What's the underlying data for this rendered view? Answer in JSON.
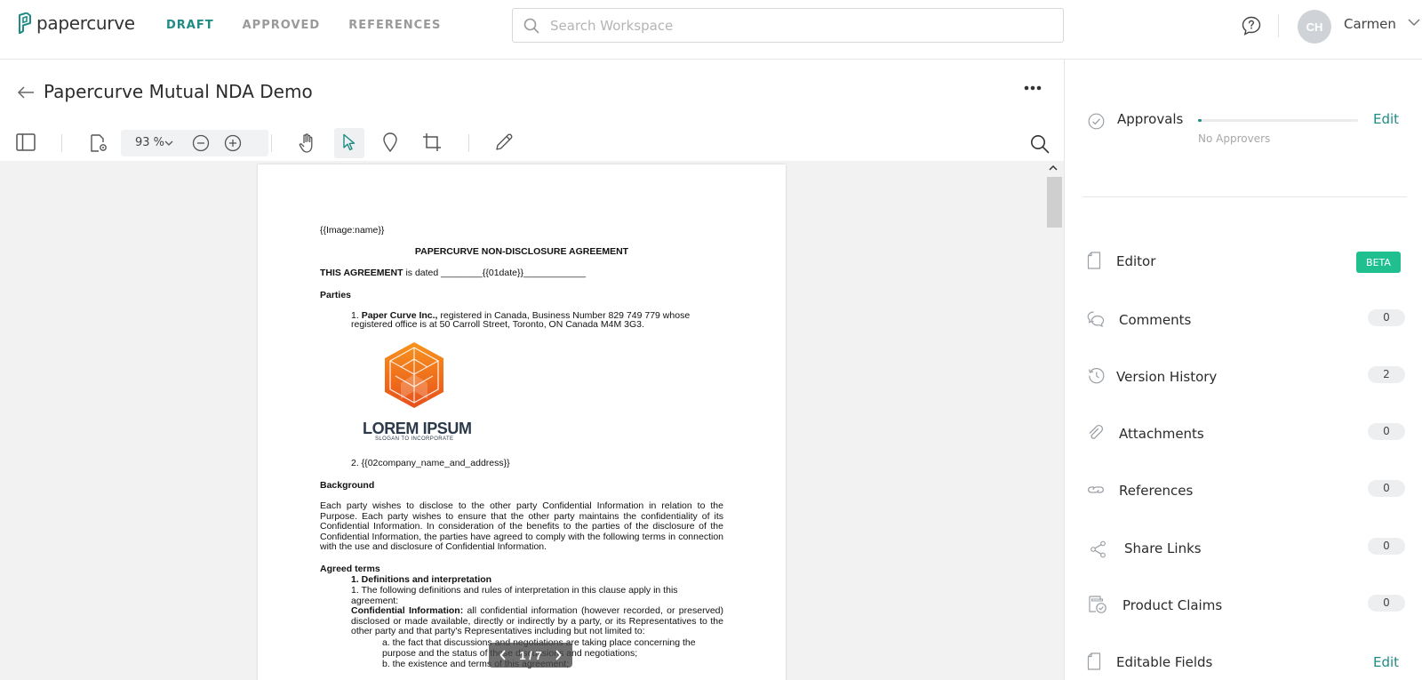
{
  "app": {
    "logo_text": "papercurve",
    "nav": [
      {
        "label": "DRAFT",
        "active": true
      },
      {
        "label": "APPROVED",
        "active": false
      },
      {
        "label": "REFERENCES",
        "active": false
      }
    ],
    "search_placeholder": "Search Workspace",
    "user": {
      "initials": "CH",
      "name": "Carmen"
    },
    "accent_color": "#1e8c85"
  },
  "document": {
    "title": "Papercurve Mutual NDA Demo",
    "zoom": "93 %",
    "pager": "1 / 7"
  },
  "page_content": {
    "image_tag": "{{Image:name}}",
    "heading": "PAPERCURVE NON-DISCLOSURE AGREEMENT",
    "dated_bold": "THIS AGREEMENT",
    "dated_rest": " is dated ________{{01date}}____________",
    "parties_heading": "Parties",
    "party1_num": "1. ",
    "party1_bold": "Paper Curve Inc.,",
    "party1_rest": " registered in Canada, Business Number 829 749 779 whose",
    "party1_line2": "registered office is at 50 Carroll Street, Toronto, ON Canada M4M 3G3.",
    "logo_title": "LOREM IPSUM",
    "logo_slogan": "SLOGAN TO INCORPORATE",
    "party2": "2. {{02company_name_and_address}}",
    "background_heading": "Background",
    "background_para": "Each party wishes to disclose to the other party Confidential Information in relation to the Purpose. Each party wishes to ensure that the other party maintains the confidentiality of its Confidential Information. In consideration of the benefits to the parties of the disclosure of the Confidential Information, the parties have agreed to comply with the following terms in connection with the use and disclosure of Confidential Information.",
    "agreed_heading": "Agreed terms",
    "def_heading": "1. Definitions and interpretation",
    "def_line1": "1. The following definitions and rules of interpretation in this clause apply in this",
    "def_line2": "agreement:",
    "conf_bold": "Confidential Information:",
    "conf_rest": " all confidential information (however recorded, or preserved) disclosed or made available, directly or indirectly by a party, or its Representatives to the other party and that party's Representatives including but not limited to:",
    "item_a1": "a. the fact that discussions and negotiations are taking place concerning the",
    "item_a2": "purpose and the status of those discussions and negotiations;",
    "item_b": "b. the existence and terms of this agreement;"
  },
  "panel": {
    "approvals": {
      "label": "Approvals",
      "edit": "Edit",
      "status": "No Approvers",
      "progress": 0.02
    },
    "items": [
      {
        "label": "Editor",
        "badge": "BETA"
      },
      {
        "label": "Comments",
        "count": "0"
      },
      {
        "label": "Version History",
        "count": "2"
      },
      {
        "label": "Attachments",
        "count": "0"
      },
      {
        "label": "References",
        "count": "0"
      },
      {
        "label": "Share Links",
        "count": "0"
      },
      {
        "label": "Product Claims",
        "count": "0"
      },
      {
        "label": "Editable Fields",
        "edit": "Edit"
      }
    ]
  }
}
